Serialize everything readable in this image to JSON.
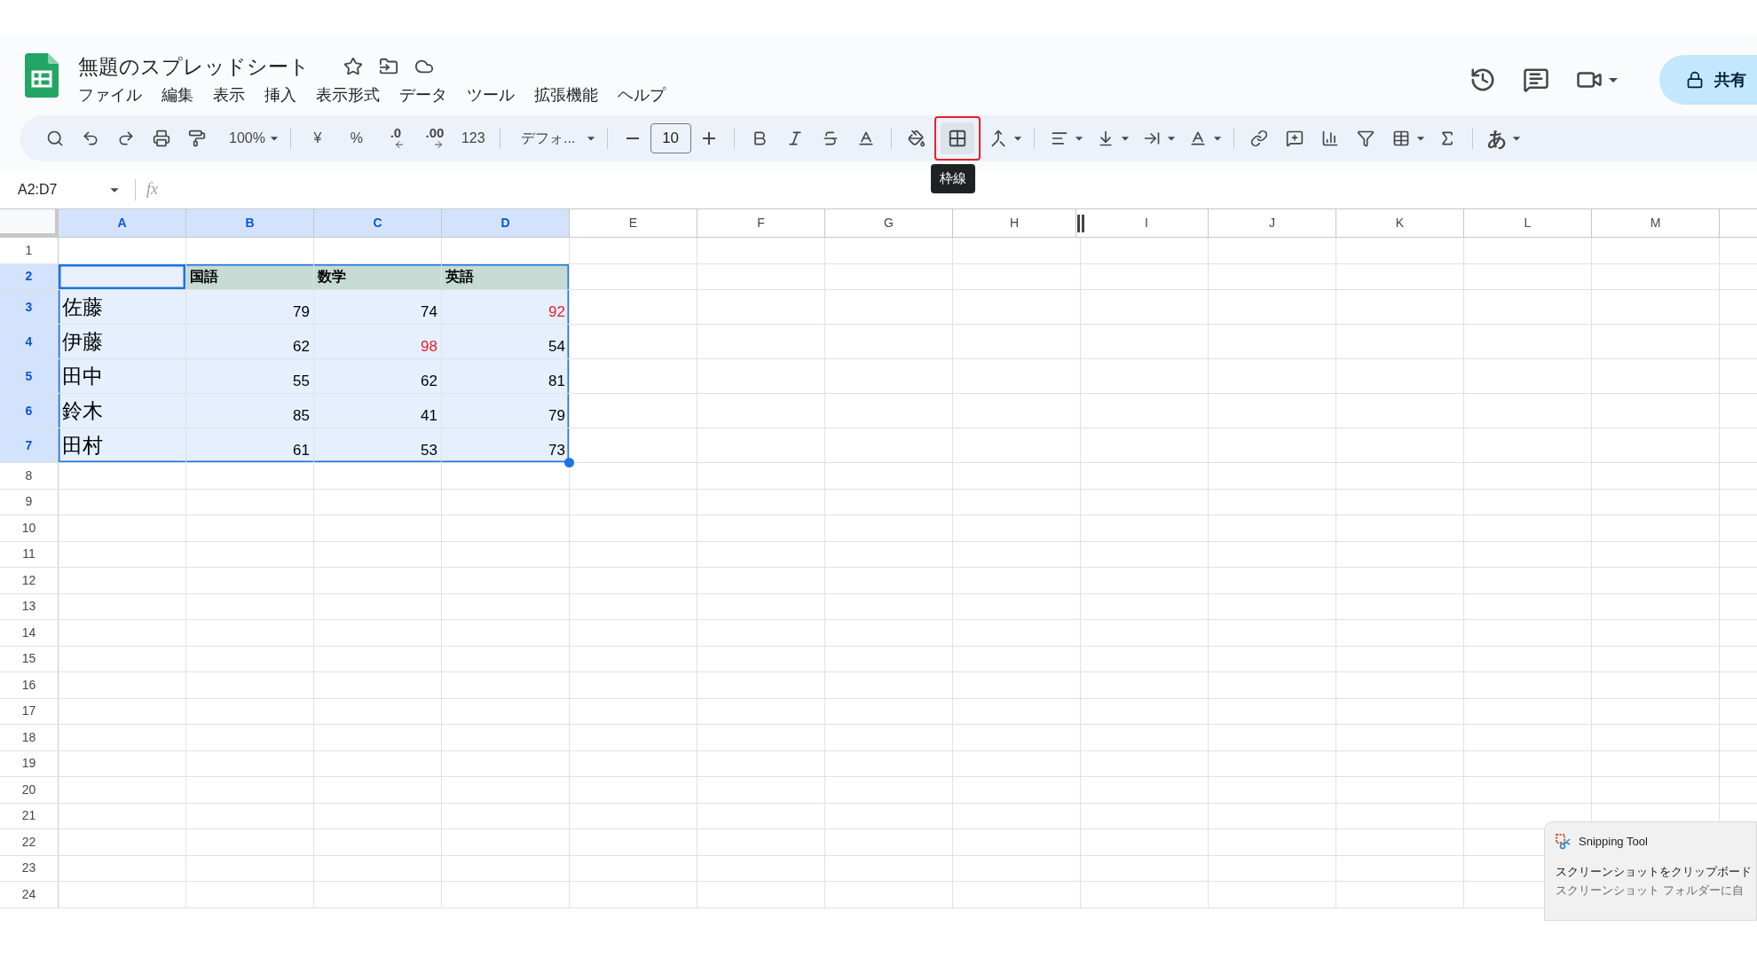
{
  "document": {
    "title": "無題のスプレッドシート"
  },
  "menu": [
    "ファイル",
    "編集",
    "表示",
    "挿入",
    "表示形式",
    "データ",
    "ツール",
    "拡張機能",
    "ヘルプ"
  ],
  "share": {
    "label": "共有"
  },
  "toolbar": {
    "zoom": "100%",
    "currency": "¥",
    "percent": "%",
    "decimal_decrease": ".0",
    "decimal_increase": ".00",
    "number_format": "123",
    "font": "デフォ...",
    "font_size": "10",
    "input_tool": "あ"
  },
  "borders": {
    "tooltip": "枠線",
    "annotated": true
  },
  "sheet": {
    "name_box": "A2:D7",
    "formula_label": "fx",
    "columns": [
      {
        "label": "A",
        "selected": true
      },
      {
        "label": "B",
        "selected": true
      },
      {
        "label": "C",
        "selected": true
      },
      {
        "label": "D",
        "selected": true
      },
      {
        "label": "E",
        "selected": false
      },
      {
        "label": "F",
        "selected": false
      },
      {
        "label": "G",
        "selected": false
      },
      {
        "label": "H",
        "selected": false
      },
      {
        "label": "I",
        "selected": false
      },
      {
        "label": "J",
        "selected": false
      },
      {
        "label": "K",
        "selected": false
      },
      {
        "label": "L",
        "selected": false
      },
      {
        "label": "M",
        "selected": false
      }
    ],
    "rows": [
      {
        "label": "1",
        "selected": false,
        "kind": "empty"
      },
      {
        "label": "2",
        "selected": true,
        "kind": "header",
        "cells": [
          "国語",
          "数学",
          "英語"
        ]
      },
      {
        "label": "3",
        "selected": true,
        "kind": "data",
        "name": "佐藤",
        "scores": [
          {
            "text": "79",
            "color": "#000000"
          },
          {
            "text": "74",
            "color": "#000000"
          },
          {
            "text": "92",
            "color": "#e8202a"
          }
        ]
      },
      {
        "label": "4",
        "selected": true,
        "kind": "data",
        "name": "伊藤",
        "scores": [
          {
            "text": "62",
            "color": "#000000"
          },
          {
            "text": "98",
            "color": "#e8202a"
          },
          {
            "text": "54",
            "color": "#000000"
          }
        ]
      },
      {
        "label": "5",
        "selected": true,
        "kind": "data",
        "name": "田中",
        "scores": [
          {
            "text": "55",
            "color": "#000000"
          },
          {
            "text": "62",
            "color": "#000000"
          },
          {
            "text": "81",
            "color": "#000000"
          }
        ]
      },
      {
        "label": "6",
        "selected": true,
        "kind": "data",
        "name": "鈴木",
        "scores": [
          {
            "text": "85",
            "color": "#000000"
          },
          {
            "text": "41",
            "color": "#000000"
          },
          {
            "text": "79",
            "color": "#000000"
          }
        ]
      },
      {
        "label": "7",
        "selected": true,
        "kind": "data",
        "name": "田村",
        "scores": [
          {
            "text": "61",
            "color": "#000000"
          },
          {
            "text": "53",
            "color": "#000000"
          },
          {
            "text": "73",
            "color": "#000000"
          }
        ]
      },
      {
        "label": "8",
        "selected": false,
        "kind": "empty"
      },
      {
        "label": "9",
        "selected": false,
        "kind": "empty"
      },
      {
        "label": "10",
        "selected": false,
        "kind": "empty"
      },
      {
        "label": "11",
        "selected": false,
        "kind": "empty"
      },
      {
        "label": "12",
        "selected": false,
        "kind": "empty"
      },
      {
        "label": "13",
        "selected": false,
        "kind": "empty"
      },
      {
        "label": "14",
        "selected": false,
        "kind": "empty"
      },
      {
        "label": "15",
        "selected": false,
        "kind": "empty"
      },
      {
        "label": "16",
        "selected": false,
        "kind": "empty"
      },
      {
        "label": "17",
        "selected": false,
        "kind": "empty"
      },
      {
        "label": "18",
        "selected": false,
        "kind": "empty"
      },
      {
        "label": "19",
        "selected": false,
        "kind": "empty"
      },
      {
        "label": "20",
        "selected": false,
        "kind": "empty"
      },
      {
        "label": "21",
        "selected": false,
        "kind": "empty"
      },
      {
        "label": "22",
        "selected": false,
        "kind": "empty"
      },
      {
        "label": "23",
        "selected": false,
        "kind": "empty"
      },
      {
        "label": "24",
        "selected": false,
        "kind": "empty"
      }
    ]
  },
  "notification": {
    "app": "Snipping Tool",
    "message": "スクリーンショットをクリップボード",
    "detail": "スクリーンショット フォルダーに自"
  }
}
